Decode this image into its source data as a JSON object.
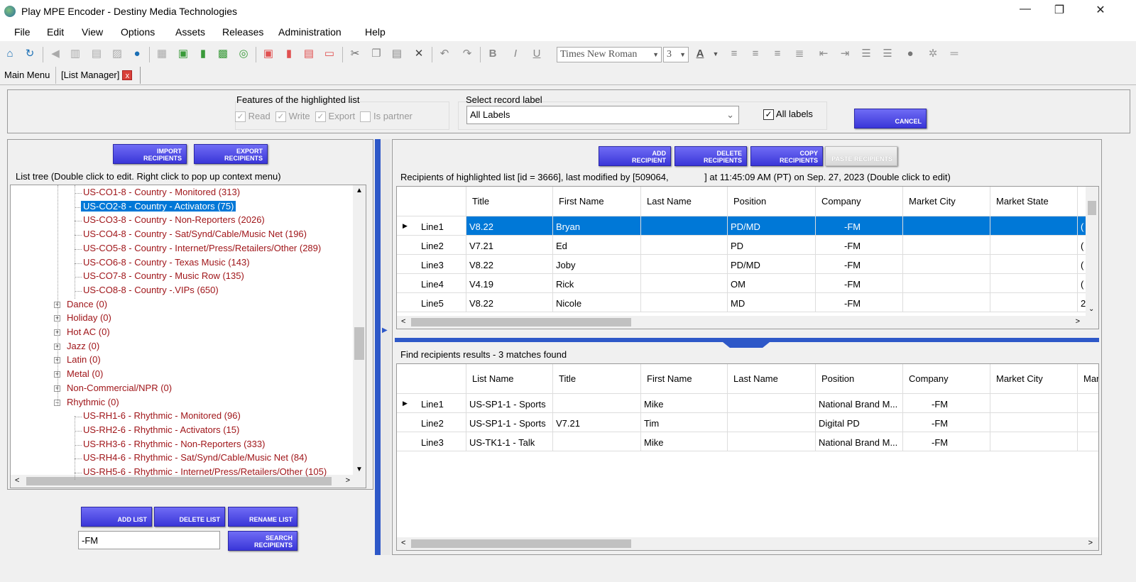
{
  "window": {
    "title": "Play MPE Encoder - Destiny Media Technologies",
    "minimize": "—",
    "restore": "❐",
    "close": "✕"
  },
  "menu": [
    "File",
    "Edit",
    "View",
    "Options",
    "Assets",
    "Releases",
    "Administration",
    "Help"
  ],
  "toolbar": {
    "font": "Times New Roman",
    "size": "3",
    "font_color_label": "A"
  },
  "tabs": [
    {
      "label": "Main Menu"
    },
    {
      "label": "[List Manager]",
      "close": "x"
    }
  ],
  "features": {
    "legend": "Features of the highlighted list",
    "read": "Read",
    "write": "Write",
    "export": "Export",
    "partner": "Is partner",
    "check": "✓"
  },
  "record_label": {
    "legend": "Select record label",
    "value": "All Labels",
    "all_labels": "All labels"
  },
  "cancel": "CANCEL",
  "left": {
    "import": [
      "IMPORT",
      "RECIPIENTS"
    ],
    "export": [
      "EXPORT",
      "RECIPIENTS"
    ],
    "tree_caption": "List tree (Double click to edit. Right click to pop up context menu)",
    "tree": [
      {
        "label": "US-CO1-8 - Country - Monitored (313)",
        "level": 2
      },
      {
        "label": "US-CO2-8 - Country - Activators (75)",
        "level": 2,
        "selected": true
      },
      {
        "label": "US-CO3-8 - Country - Non-Reporters (2026)",
        "level": 2
      },
      {
        "label": "US-CO4-8 - Country - Sat/Synd/Cable/Music Net (196)",
        "level": 2
      },
      {
        "label": "US-CO5-8 - Country - Internet/Press/Retailers/Other (289)",
        "level": 2
      },
      {
        "label": "US-CO6-8 - Country - Texas Music (143)",
        "level": 2
      },
      {
        "label": "US-CO7-8 - Country - Music Row (135)",
        "level": 2
      },
      {
        "label": "US-CO8-8 - Country -.VIPs (650)",
        "level": 2
      },
      {
        "label": "Dance (0)",
        "level": 1,
        "exp": "+"
      },
      {
        "label": "Holiday (0)",
        "level": 1,
        "exp": "+"
      },
      {
        "label": "Hot AC (0)",
        "level": 1,
        "exp": "+"
      },
      {
        "label": "Jazz (0)",
        "level": 1,
        "exp": "+"
      },
      {
        "label": "Latin (0)",
        "level": 1,
        "exp": "+"
      },
      {
        "label": "Metal (0)",
        "level": 1,
        "exp": "+"
      },
      {
        "label": "Non-Commercial/NPR (0)",
        "level": 1,
        "exp": "+"
      },
      {
        "label": "Rhythmic (0)",
        "level": 1,
        "exp": "−"
      },
      {
        "label": "US-RH1-6 - Rhythmic - Monitored (96)",
        "level": 2
      },
      {
        "label": "US-RH2-6 - Rhythmic - Activators (15)",
        "level": 2
      },
      {
        "label": "US-RH3-6 - Rhythmic - Non-Reporters (333)",
        "level": 2
      },
      {
        "label": "US-RH4-6 - Rhythmic - Sat/Synd/Cable/Music Net (84)",
        "level": 2
      },
      {
        "label": "US-RH5-6 - Rhythmic - Internet/Press/Retailers/Other (105)",
        "level": 2
      }
    ],
    "add_list": "ADD LIST",
    "delete_list": "DELETE LIST",
    "rename_list": "RENAME LIST",
    "search": [
      "SEARCH",
      "RECIPIENTS"
    ],
    "search_value": "-FM"
  },
  "right": {
    "add": [
      "ADD",
      "RECIPIENT"
    ],
    "delete": [
      "DELETE",
      "RECIPIENTS"
    ],
    "copy": [
      "COPY",
      "RECIPIENTS"
    ],
    "paste": "PASTE RECIPIENTS",
    "caption": "Recipients of highlighted list [id = 3666], last modified by [509064,              ] at 11:45:09 AM (PT) on Sep. 27, 2023 (Double click to edit)",
    "columns": [
      "",
      "Title",
      "First Name",
      "Last Name",
      "Position",
      "Company",
      "Market City",
      "Market State",
      ""
    ],
    "rows": [
      [
        "Line1",
        "V8.22",
        "Bryan",
        "",
        "PD/MD",
        "-FM",
        "",
        "",
        "("
      ],
      [
        "Line2",
        "V7.21",
        "Ed",
        "",
        "PD",
        "-FM",
        "",
        "",
        "("
      ],
      [
        "Line3",
        "V8.22",
        "Joby",
        "",
        "PD/MD",
        "-FM",
        "",
        "",
        "("
      ],
      [
        "Line4",
        "V4.19",
        "Rick",
        "",
        "OM",
        "-FM",
        "",
        "",
        "("
      ],
      [
        "Line5",
        "V8.22",
        "Nicole",
        "",
        "MD",
        "-FM",
        "",
        "",
        "2"
      ]
    ],
    "find_caption": "Find recipients results - 3 matches found",
    "find_columns": [
      "",
      "List Name",
      "Title",
      "First Name",
      "Last Name",
      "Position",
      "Company",
      "Market City",
      "Mar"
    ],
    "find_rows": [
      [
        "Line1",
        "US-SP1-1 - Sports",
        "",
        "Mike",
        "",
        "National Brand M...",
        "-FM",
        "",
        ""
      ],
      [
        "Line2",
        "US-SP1-1 - Sports",
        "V7.21",
        "Tim",
        "",
        "Digital PD",
        "-FM",
        "",
        ""
      ],
      [
        "Line3",
        "US-TK1-1 - Talk",
        "",
        "Mike",
        "",
        "National Brand M...",
        "-FM",
        "",
        ""
      ]
    ]
  }
}
